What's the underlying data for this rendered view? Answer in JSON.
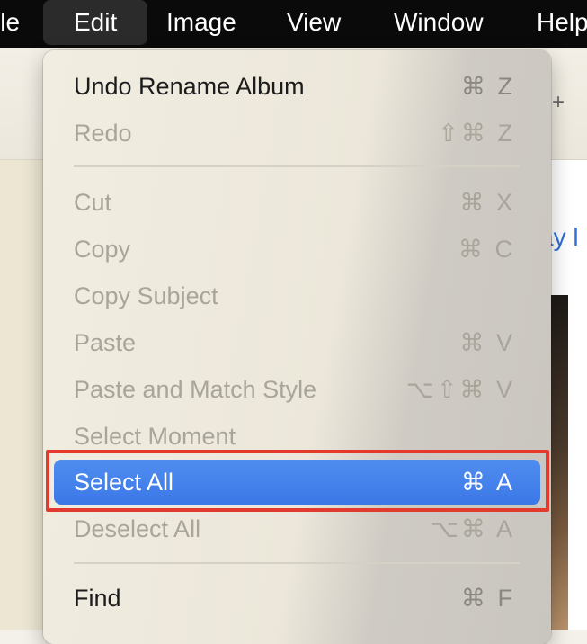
{
  "menubar": {
    "items": [
      {
        "label": "ile"
      },
      {
        "label": "Edit"
      },
      {
        "label": "Image"
      },
      {
        "label": "View"
      },
      {
        "label": "Window"
      },
      {
        "label": "Help"
      }
    ],
    "active_index": 1
  },
  "background": {
    "link_text": "ay l",
    "plus": "+"
  },
  "edit_menu": {
    "items": [
      {
        "label": "Undo Rename Album",
        "shortcut": "⌘ Z",
        "enabled": true
      },
      {
        "label": "Redo",
        "shortcut": "⇧⌘ Z",
        "enabled": false
      },
      {
        "label": "Cut",
        "shortcut": "⌘ X",
        "enabled": false
      },
      {
        "label": "Copy",
        "shortcut": "⌘ C",
        "enabled": false
      },
      {
        "label": "Copy Subject",
        "shortcut": "",
        "enabled": false
      },
      {
        "label": "Paste",
        "shortcut": "⌘ V",
        "enabled": false
      },
      {
        "label": "Paste and Match Style",
        "shortcut": "⌥⇧⌘ V",
        "enabled": false
      },
      {
        "label": "Select Moment",
        "shortcut": "",
        "enabled": false
      },
      {
        "label": "Select All",
        "shortcut": "⌘ A",
        "enabled": true,
        "selected": true
      },
      {
        "label": "Deselect All",
        "shortcut": "⌥⌘ A",
        "enabled": false
      },
      {
        "label": "Find",
        "shortcut": "⌘ F",
        "enabled": true
      }
    ]
  },
  "colors": {
    "selection": "#3b78e7",
    "annotation_box": "#e23a2f"
  }
}
